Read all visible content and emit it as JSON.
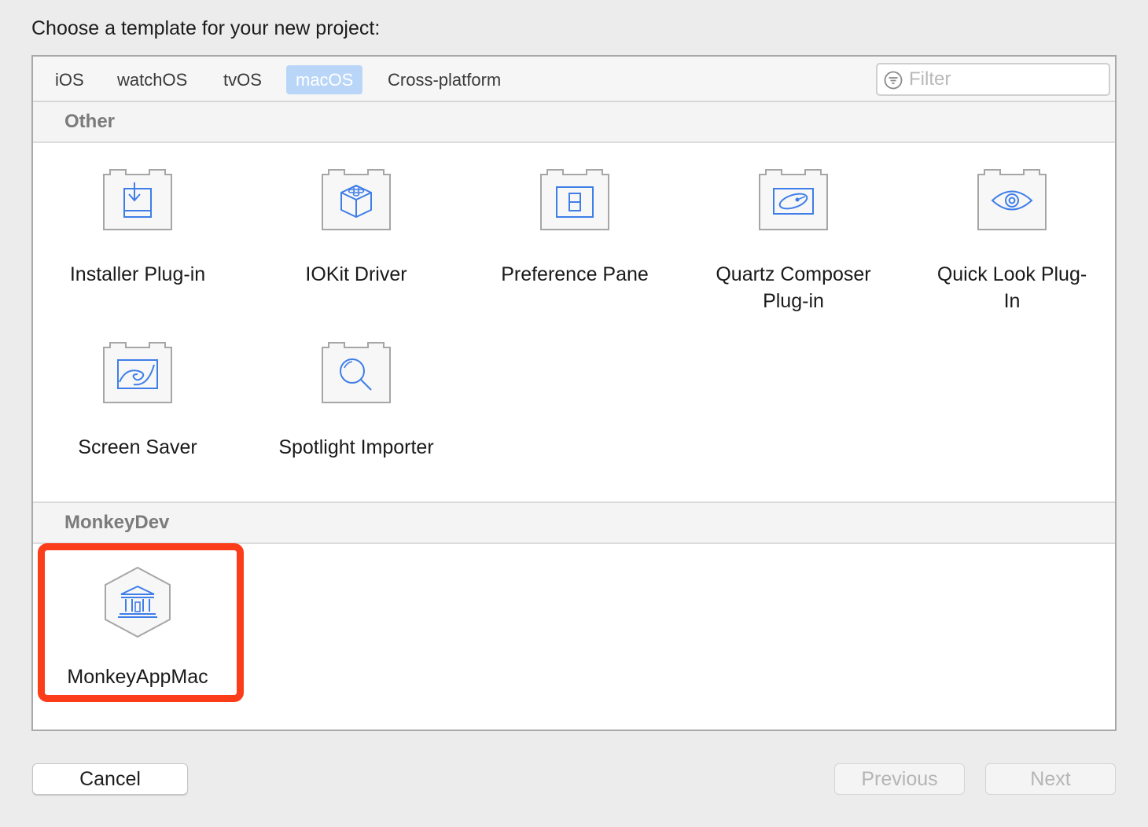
{
  "prompt": "Choose a template for your new project:",
  "tabs": [
    {
      "label": "iOS",
      "selected": false
    },
    {
      "label": "watchOS",
      "selected": false
    },
    {
      "label": "tvOS",
      "selected": false
    },
    {
      "label": "macOS",
      "selected": true
    },
    {
      "label": "Cross-platform",
      "selected": false
    }
  ],
  "filter": {
    "placeholder": "Filter",
    "value": ""
  },
  "sections": [
    {
      "title": "Other",
      "items": [
        {
          "label_lines": [
            "Installer Plug-in"
          ],
          "icon": "installer-icon"
        },
        {
          "label_lines": [
            "IOKit Driver"
          ],
          "icon": "iokit-cube-icon"
        },
        {
          "label_lines": [
            "Preference Pane"
          ],
          "icon": "preference-pane-icon"
        },
        {
          "label_lines": [
            "Quartz Composer",
            "Plug-in"
          ],
          "icon": "quartz-composer-icon"
        },
        {
          "label_lines": [
            "Quick Look Plug-",
            "In"
          ],
          "icon": "eye-icon"
        },
        {
          "label_lines": [
            "Screen Saver"
          ],
          "icon": "screen-saver-icon"
        },
        {
          "label_lines": [
            "Spotlight Importer"
          ],
          "icon": "magnifier-icon"
        }
      ]
    },
    {
      "title": "MonkeyDev",
      "items": [
        {
          "label_lines": [
            "MonkeyAppMac"
          ],
          "icon": "bank-building-icon",
          "highlighted": true
        }
      ]
    }
  ],
  "buttons": {
    "cancel": "Cancel",
    "previous": "Previous",
    "next": "Next"
  },
  "colors": {
    "accent": "#3f7ee8",
    "highlight": "#fc3d19",
    "tab_selected": "#b9d6f8"
  }
}
